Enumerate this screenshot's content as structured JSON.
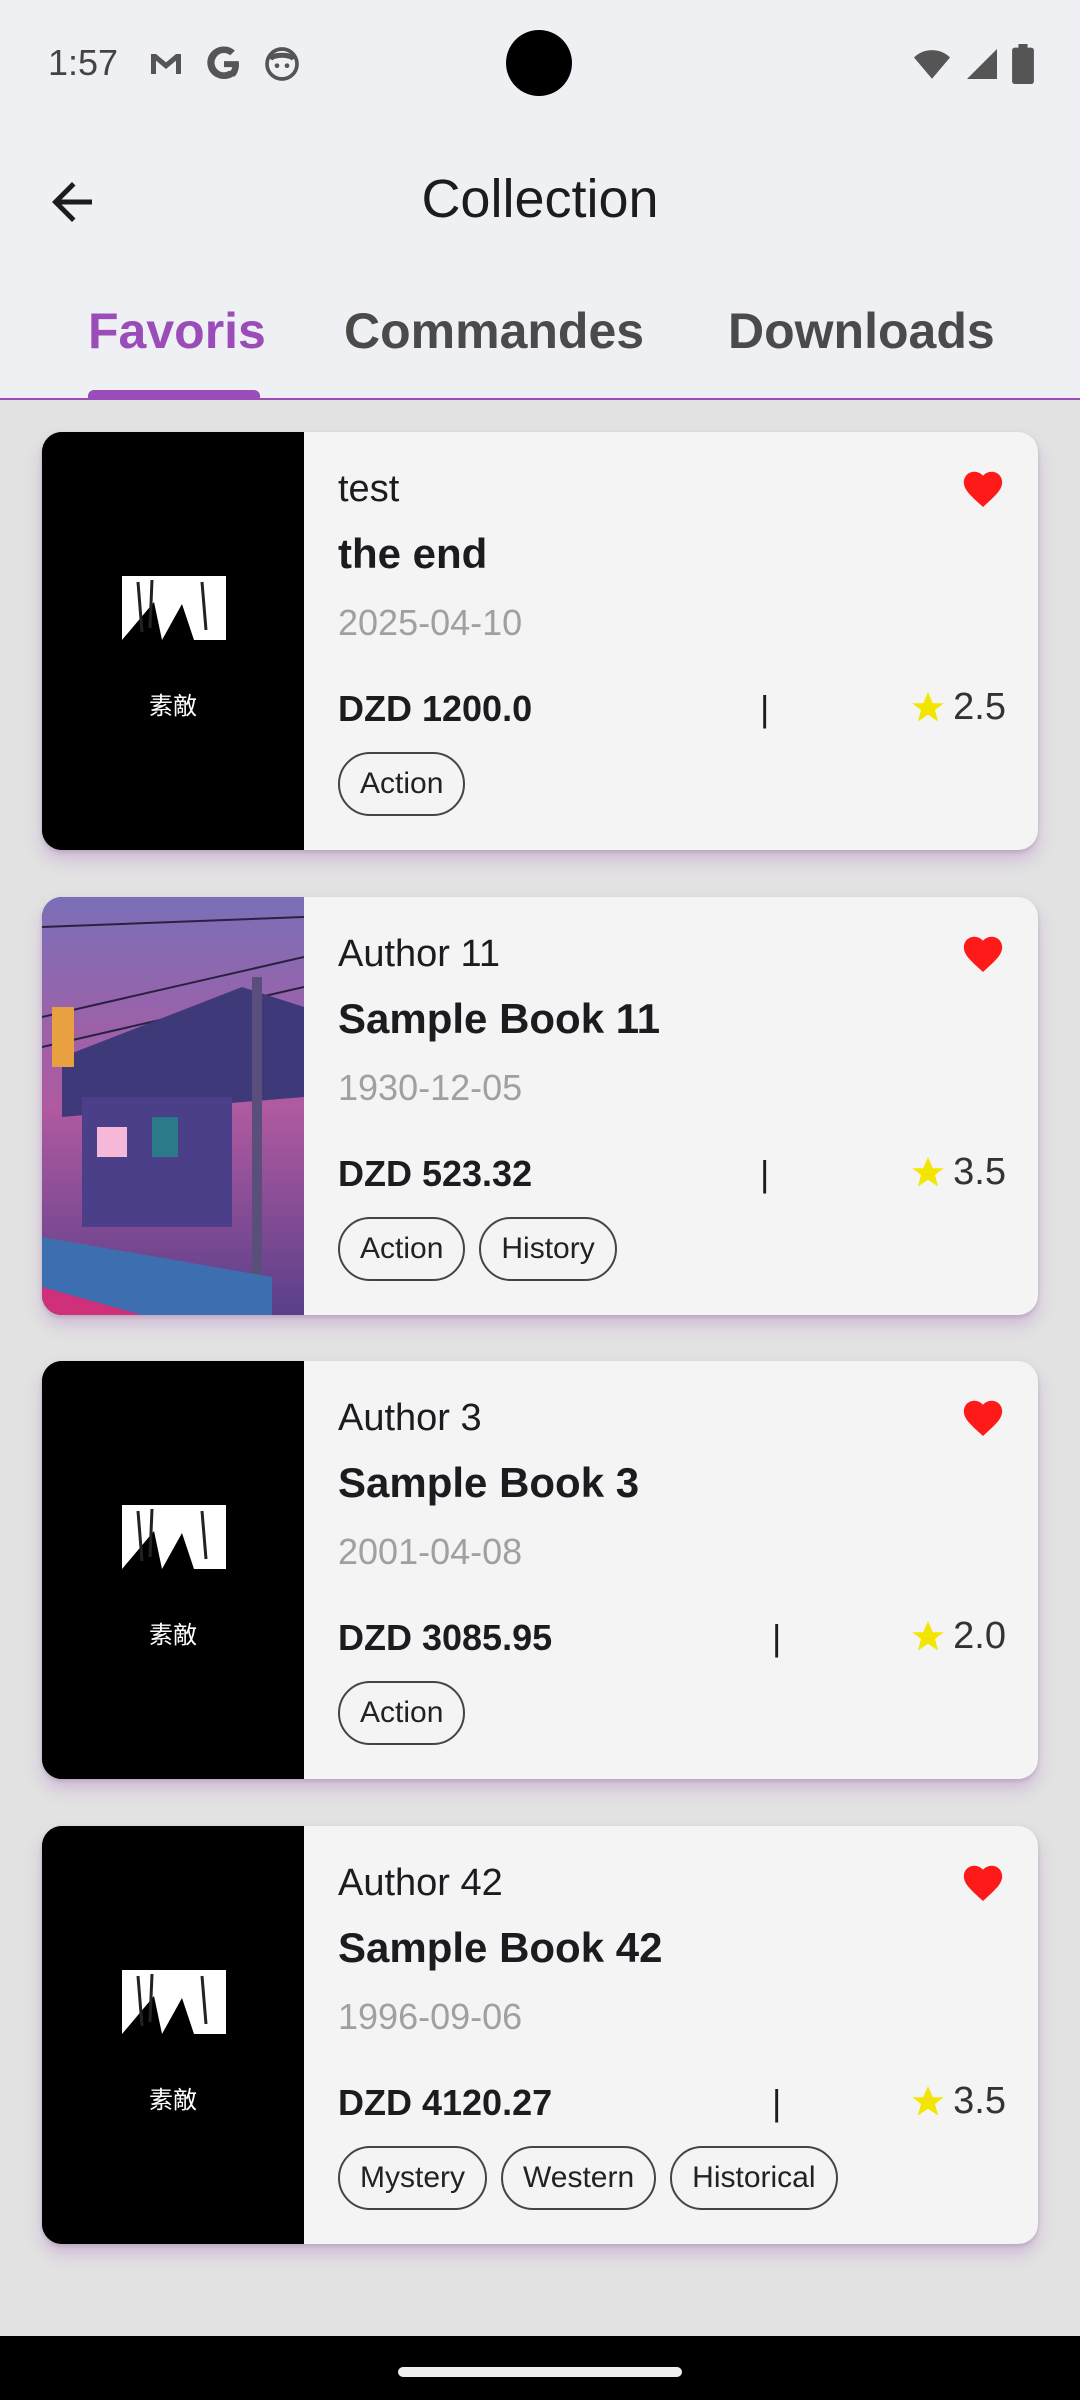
{
  "status": {
    "time": "1:57"
  },
  "app": {
    "title": "Collection"
  },
  "tabs": [
    {
      "label": "Favoris",
      "active": true
    },
    {
      "label": "Commandes",
      "active": false
    },
    {
      "label": "Downloads",
      "active": false
    }
  ],
  "books": [
    {
      "author": "test",
      "title": "the end",
      "date": "2025-04-10",
      "price": "DZD 1200.0",
      "separator": "|",
      "rating": "2.5",
      "tags": [
        "Action"
      ],
      "cover": "black-art",
      "cover_text": "素敵",
      "favorite": true
    },
    {
      "author": "Author 11",
      "title": "Sample Book 11",
      "date": "1930-12-05",
      "price": "DZD 523.32",
      "separator": "|",
      "rating": "3.5",
      "tags": [
        "Action",
        "History"
      ],
      "cover": "city-street",
      "favorite": true
    },
    {
      "author": "Author 3",
      "title": "Sample Book 3",
      "date": "2001-04-08",
      "price": "DZD 3085.95",
      "separator": "|",
      "rating": "2.0",
      "tags": [
        "Action"
      ],
      "cover": "black-art",
      "cover_text": "素敵",
      "favorite": true
    },
    {
      "author": "Author 42",
      "title": "Sample Book 42",
      "date": "1996-09-06",
      "price": "DZD 4120.27",
      "separator": "|",
      "rating": "3.5",
      "tags": [
        "Mystery",
        "Western",
        "Historical"
      ],
      "cover": "black-art",
      "cover_text": "素敵",
      "favorite": true
    }
  ],
  "colors": {
    "accent": "#9a4db8",
    "heart": "#ff1a1a",
    "star": "#f2e600",
    "card_bg": "#f4f4f4",
    "page_bg": "#e2e2e2",
    "topbar_bg": "#eef0f4"
  },
  "icons": {
    "back": "arrow-left-icon",
    "favorite": "heart-icon",
    "rating": "star-icon",
    "status": [
      "gmail-icon",
      "google-icon",
      "face-icon",
      "wifi-icon",
      "signal-icon",
      "battery-icon"
    ]
  }
}
